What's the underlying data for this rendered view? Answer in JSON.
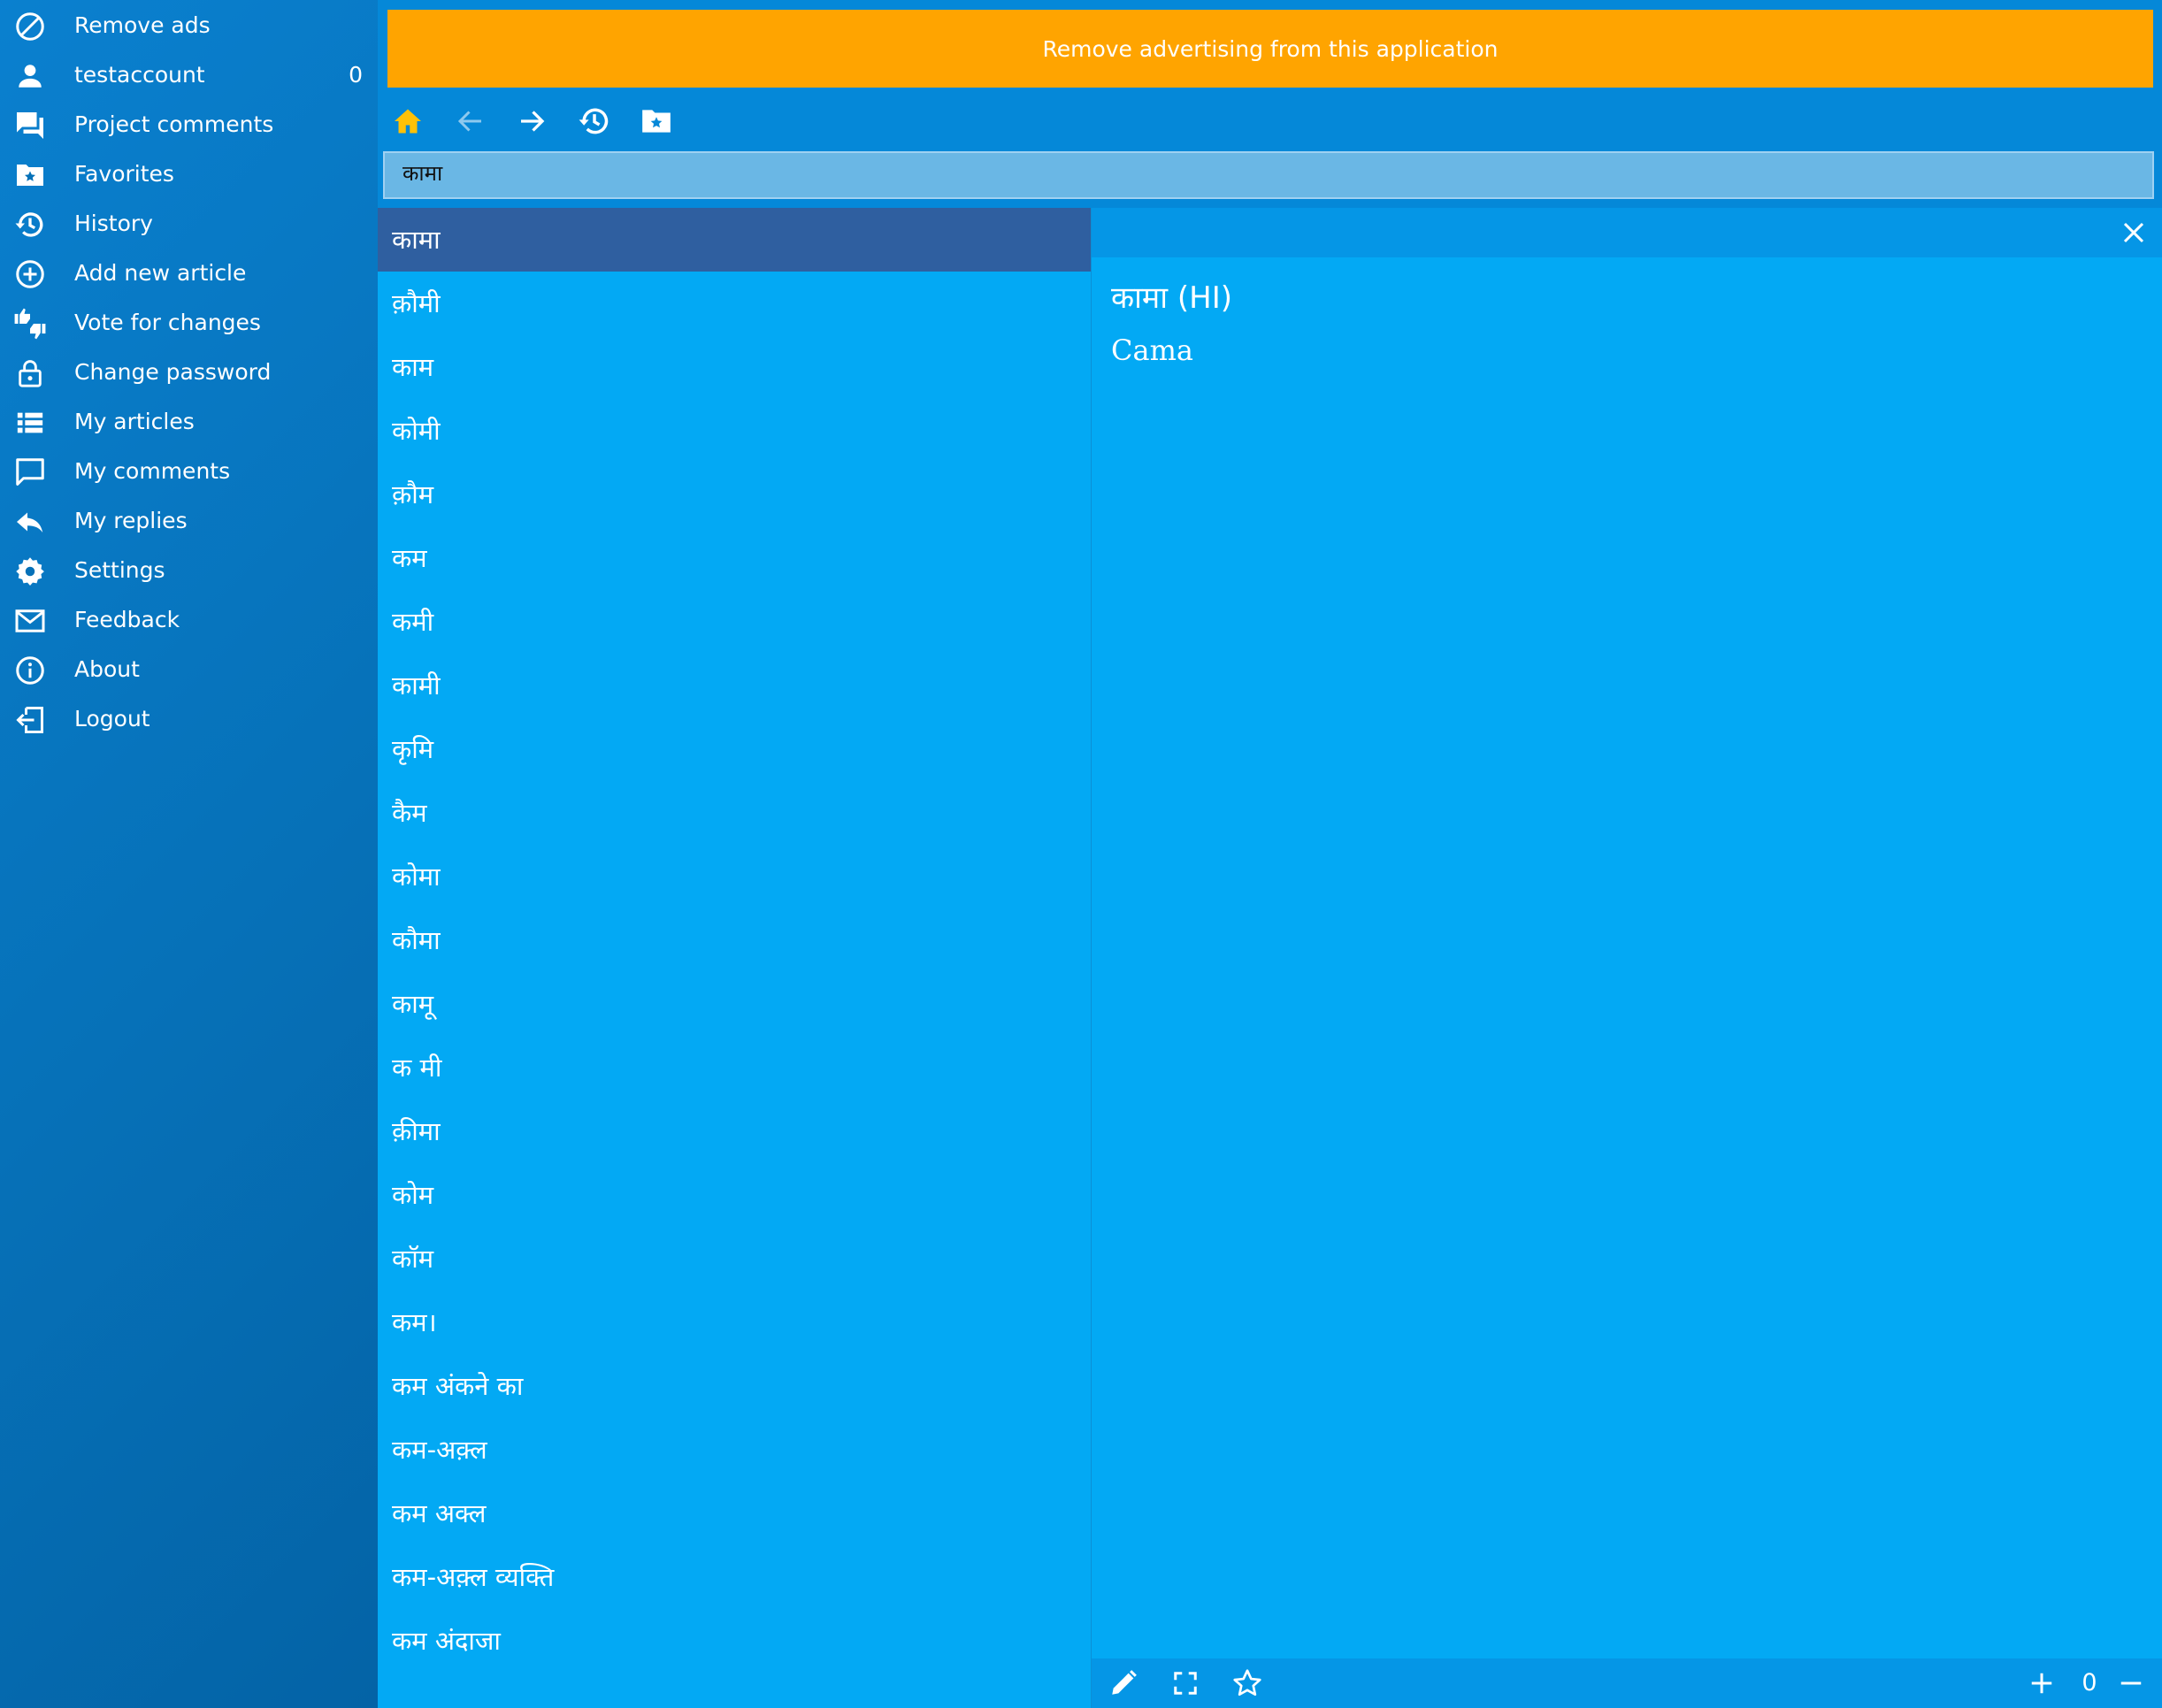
{
  "sidebar": {
    "items": [
      {
        "label": "Remove ads",
        "icon": "block-icon"
      },
      {
        "label": "testaccount",
        "icon": "user-icon",
        "count": "0"
      },
      {
        "label": "Project comments",
        "icon": "forum-icon"
      },
      {
        "label": "Favorites",
        "icon": "favorite-folder-icon"
      },
      {
        "label": "History",
        "icon": "history-icon"
      },
      {
        "label": "Add new article",
        "icon": "add-circle-icon"
      },
      {
        "label": "Vote for changes",
        "icon": "thumbs-up-down-icon"
      },
      {
        "label": "Change password",
        "icon": "lock-icon"
      },
      {
        "label": "My articles",
        "icon": "list-icon"
      },
      {
        "label": "My comments",
        "icon": "comment-icon"
      },
      {
        "label": "My replies",
        "icon": "reply-icon"
      },
      {
        "label": "Settings",
        "icon": "gear-icon"
      },
      {
        "label": "Feedback",
        "icon": "mail-icon"
      },
      {
        "label": "About",
        "icon": "info-icon"
      },
      {
        "label": "Logout",
        "icon": "logout-icon"
      }
    ]
  },
  "ad_banner": {
    "text": "Remove advertising from this application"
  },
  "toolbar": {
    "buttons": [
      "home-icon",
      "back-arrow-icon",
      "forward-arrow-icon",
      "history-icon",
      "favorite-folder-icon"
    ]
  },
  "search": {
    "value": "कामा"
  },
  "word_list": {
    "selected_index": 0,
    "items": [
      "कामा",
      "क़ौमी",
      "काम",
      "कोमी",
      "क़ौम",
      "कम",
      "कमी",
      "कामी",
      "कृमि",
      "कैम",
      "कोमा",
      "कौमा",
      "कामू",
      "क मी",
      "क़ीमा",
      "कोम",
      "कॉम",
      "कम।",
      "कम अंकने का",
      "कम-अक़्ल",
      "कम अक्ल",
      "कम-अक़्ल व्यक्ति",
      "कम अंदाजा"
    ]
  },
  "article": {
    "title": "कामा (HI)",
    "body": "Cama",
    "zoom_value": "0"
  },
  "colors": {
    "sidebar": "#0671b8",
    "ad_banner": "#ffa400",
    "list_background": "#03a9f4",
    "selected_item": "#2f5fa0",
    "home_icon": "#ffc107"
  }
}
